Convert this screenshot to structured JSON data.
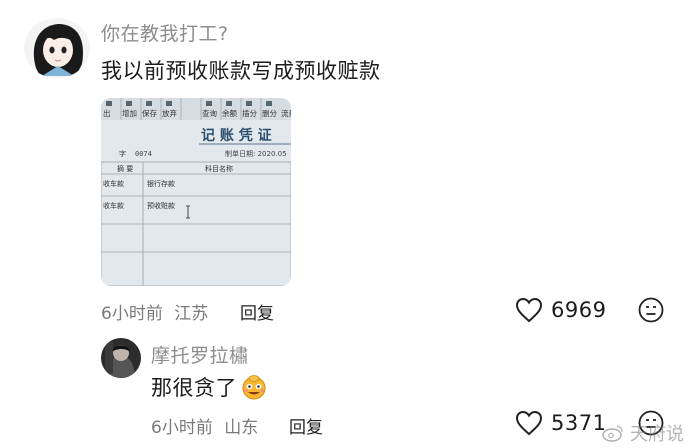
{
  "comments": [
    {
      "username": "你在教我打工?",
      "text": "我以前预收账款写成预收赃款",
      "time": "6小时前",
      "location": "江苏",
      "reply_label": "回复",
      "likes": "6969",
      "attachment": {
        "toolbar_labels": [
          "出",
          "增加",
          "保存",
          "放弃",
          "查询",
          "余额",
          "插分",
          "删分",
          "流量"
        ],
        "title": "记 账 凭 证",
        "voucher_label": "字",
        "voucher_no": "0074",
        "date_text": "制单日期: 2020.05",
        "col_summary": "摘 要",
        "col_account": "科目名称",
        "rows": [
          {
            "summary": "收车款",
            "account": "银行存款"
          },
          {
            "summary": "收车款",
            "account": "预收赃款"
          }
        ]
      }
    },
    {
      "username": "摩托罗拉橚",
      "text": "那很贪了",
      "time": "6小时前",
      "location": "山东",
      "reply_label": "回复",
      "likes": "5371"
    }
  ],
  "watermark": "天府说",
  "icons": {
    "like": "heart-outline-icon",
    "react": "meh-face-icon",
    "emoji": "money-face-emoji",
    "watermark": "weibo-icon"
  },
  "colors": {
    "username": "#8d8d8d",
    "text": "#1d1d1d",
    "meta": "#7a7a7a"
  }
}
